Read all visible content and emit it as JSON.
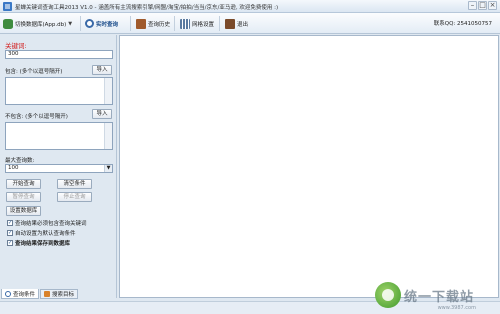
{
  "window": {
    "title": "星蝉关键词查询工具2013 V1.0 - 涵盖所有主流搜索引擎/网盟/淘宝/拍拍/当当/京东/亚马逊, 欢迎免费使用 :)",
    "controls": [
      "–",
      "□",
      "×"
    ]
  },
  "toolbar": {
    "items": [
      {
        "label": "切换数据库(App.db)",
        "icon": "database-icon"
      },
      {
        "label": "实时查询",
        "icon": "search-icon"
      },
      {
        "label": "查询历史",
        "icon": "history-book-icon"
      },
      {
        "label": "网格设置",
        "icon": "grid-settings-icon"
      },
      {
        "label": "退出",
        "icon": "exit-icon"
      }
    ],
    "contact": "联系QQ: 2541050757"
  },
  "form": {
    "keyword_label": "关键词:",
    "keyword_value": "300",
    "include_label": "包含: (多个以逗号隔开)",
    "include_import": "导入",
    "exclude_label": "不包含: (多个以逗号隔开)",
    "exclude_import": "导入",
    "max_label": "最大查询数:",
    "max_value": "100",
    "buttons": {
      "start": "开始查询",
      "clear": "清空条件",
      "pause": "暂停查询",
      "stop": "停止查询",
      "db_settings": "设置数据库"
    },
    "checkboxes": [
      {
        "label": "查询结果必须包含查询关键词",
        "checked": true
      },
      {
        "label": "自动设置为默认查询条件",
        "checked": true
      },
      {
        "label": "查询结果保存到数据库",
        "checked": true
      }
    ]
  },
  "tabs": [
    {
      "label": "查询条件",
      "icon": "search-icon",
      "active": true
    },
    {
      "label": "搜索目标",
      "icon": "target-icon",
      "active": false
    }
  ],
  "watermark": {
    "brand": "统一下载站",
    "url": "www.3987.com"
  }
}
